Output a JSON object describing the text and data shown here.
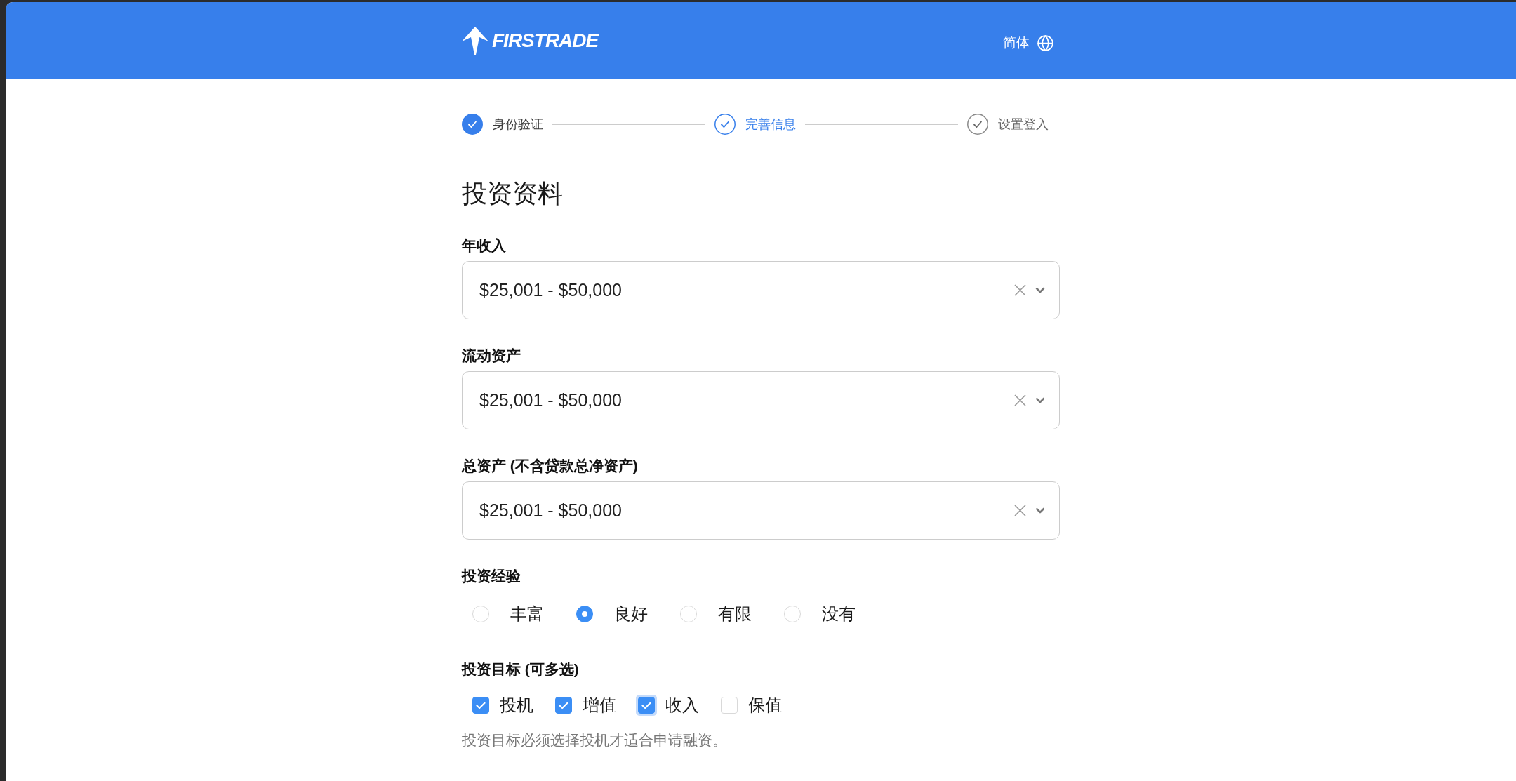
{
  "header": {
    "logo_text": "FIRSTRADE",
    "language": "简体"
  },
  "steps": [
    {
      "label": "身份验证",
      "completed": true,
      "selected": false
    },
    {
      "label": "完善信息",
      "completed": false,
      "selected": true
    },
    {
      "label": "设置登入",
      "completed": false,
      "selected": false
    }
  ],
  "section_title": "投资资料",
  "selects": [
    {
      "label": "年收入",
      "value": "$25,001 - $50,000"
    },
    {
      "label": "流动资产",
      "value": "$25,001 - $50,000"
    },
    {
      "label": "总资产 (不含贷款总净资产)",
      "value": "$25,001 - $50,000"
    }
  ],
  "experience": {
    "label": "投资经验",
    "options": [
      {
        "label": "丰富",
        "selected": false
      },
      {
        "label": "良好",
        "selected": true
      },
      {
        "label": "有限",
        "selected": false
      },
      {
        "label": "没有",
        "selected": false
      }
    ]
  },
  "objectives": {
    "label": "投资目标 (可多选)",
    "options": [
      {
        "label": "投机",
        "checked": true,
        "focused": false
      },
      {
        "label": "增值",
        "checked": true,
        "focused": false
      },
      {
        "label": "收入",
        "checked": true,
        "focused": true
      },
      {
        "label": "保值",
        "checked": false,
        "focused": false
      }
    ],
    "note": "投资目标必须选择投机才适合申请融资。"
  }
}
